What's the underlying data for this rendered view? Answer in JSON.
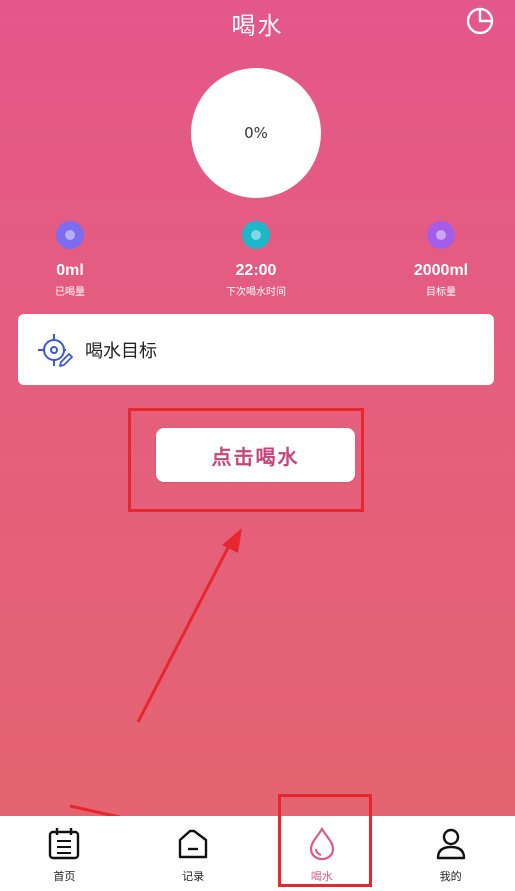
{
  "header": {
    "title": "喝水",
    "chart_icon": "pie-chart-icon"
  },
  "progress": {
    "percent_text": "0%"
  },
  "stats": [
    {
      "value": "0ml",
      "label": "已喝量",
      "color": "#7b6cf0"
    },
    {
      "value": "22:00",
      "label": "下次喝水时间",
      "color": "#1eb7c9"
    },
    {
      "value": "2000ml",
      "label": "目标量",
      "color": "#a35de8"
    }
  ],
  "goal_card": {
    "label": "喝水目标",
    "icon": "target-edit-icon",
    "icon_color": "#3c58d2"
  },
  "drink_button": {
    "label": "点击喝水",
    "color": "#c8457b"
  },
  "annotation": {
    "color": "#e8262f"
  },
  "bottom_nav": [
    {
      "label": "首页",
      "icon": "calendar-icon",
      "active": false
    },
    {
      "label": "记录",
      "icon": "record-icon",
      "active": false
    },
    {
      "label": "喝水",
      "icon": "water-drop-icon",
      "active": true
    },
    {
      "label": "我的",
      "icon": "user-icon",
      "active": false
    }
  ]
}
